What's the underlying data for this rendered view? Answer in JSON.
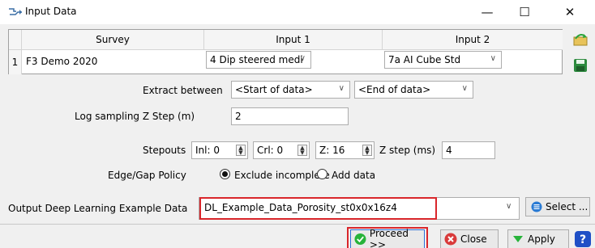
{
  "window": {
    "title": "Input Data",
    "minimize": "—",
    "maximize": "☐",
    "close": "✕"
  },
  "table": {
    "headers": [
      "Survey",
      "Input 1",
      "Input 2"
    ],
    "rows": [
      {
        "num": "1",
        "survey": "F3 Demo 2020",
        "input1": "4 Dip steered medi",
        "input2": "7a AI Cube Std"
      }
    ]
  },
  "extract": {
    "label": "Extract between",
    "start": "<Start of data>",
    "end": "<End of data>"
  },
  "log_sampling": {
    "label": "Log sampling Z Step (m)",
    "value": "2"
  },
  "stepouts": {
    "label": "Stepouts",
    "inl": "Inl: 0",
    "crl": "Crl: 0",
    "z": "Z: 16",
    "zstep_label": "Z step (ms)",
    "zstep_value": "4"
  },
  "edge_gap": {
    "label": "Edge/Gap Policy",
    "option_exclude": "Exclude incomplete",
    "option_add": "Add data",
    "selected": "Exclude incomplete"
  },
  "output": {
    "label": "Output Deep Learning Example Data",
    "value": "DL_Example_Data_Porosity_st0x0x16z4",
    "select_label": "Select ..."
  },
  "buttons": {
    "proceed": "Proceed >>",
    "close": "Close",
    "apply": "Apply"
  },
  "colors": {
    "highlight": "#d9262b",
    "accent": "#2b6fd6",
    "proceed_icon": "#27b33a",
    "close_icon": "#d93a3a",
    "help_icon": "#1f4fc6"
  }
}
